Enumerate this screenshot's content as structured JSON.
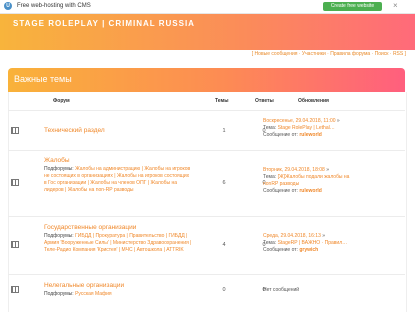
{
  "topbar": {
    "text": "Free web-hosting with CMS",
    "button": "Create free website"
  },
  "site": {
    "title": "STAGE ROLEPLAY | CRIMINAL RUSSIA"
  },
  "nav": {
    "links": "[ Новые сообщения · Участники · Правила форума · Поиск · RSS ]"
  },
  "panel": {
    "title": "Важные темы"
  },
  "columns": {
    "forum": "Форум",
    "topics": "Темы",
    "replies": "Ответы",
    "updates": "Обновления"
  },
  "labels": {
    "subforums": "Подфорумы:",
    "topic": "Тема:",
    "by": "Сообщение от:",
    "no_posts": "Нет сообщений"
  },
  "forums": [
    {
      "name": "Технический раздел",
      "subforums": "",
      "topics": "1",
      "replies": "0",
      "date": "Воскресенье, 29.04.2018, 11:00",
      "topic": "Stage RolePlay | Lethal…",
      "author": "ruleworld"
    },
    {
      "name": "Жалобы",
      "subforums": "Жалобы на администрацию | Жалобы на игроков не состоящих в организациях | Жалобы на игроков состоящих в Гос организации | Жалобы на членов ОПГ | Жалобы на лидеров | Жалобы на non-RP разводы",
      "topics": "6",
      "replies": "0",
      "date": "Вторник, 29.04.2018, 18:08",
      "topic": "[Ж]Жалобы подали жалобы на nonRP разводы",
      "author": "ruleworld"
    },
    {
      "name": "Государственные организации",
      "subforums": "ГИБДД | Прокуратура | Правительство | ГИБДД | Армия 'Вооруженные Силы' | Министерство Здравоохранения | Теле-Радио Компания 'Кристея' | МЧС | Автошкола | ATTRIK",
      "topics": "4",
      "replies": "0",
      "date": "Среда, 29.04.2018, 16:13",
      "topic": "StageRP | ВАЖНО · Правил…",
      "author": "grywich"
    },
    {
      "name": "Нелегальные организации",
      "subforums": "Русская Мафия",
      "topics": "0",
      "replies": "0"
    }
  ]
}
